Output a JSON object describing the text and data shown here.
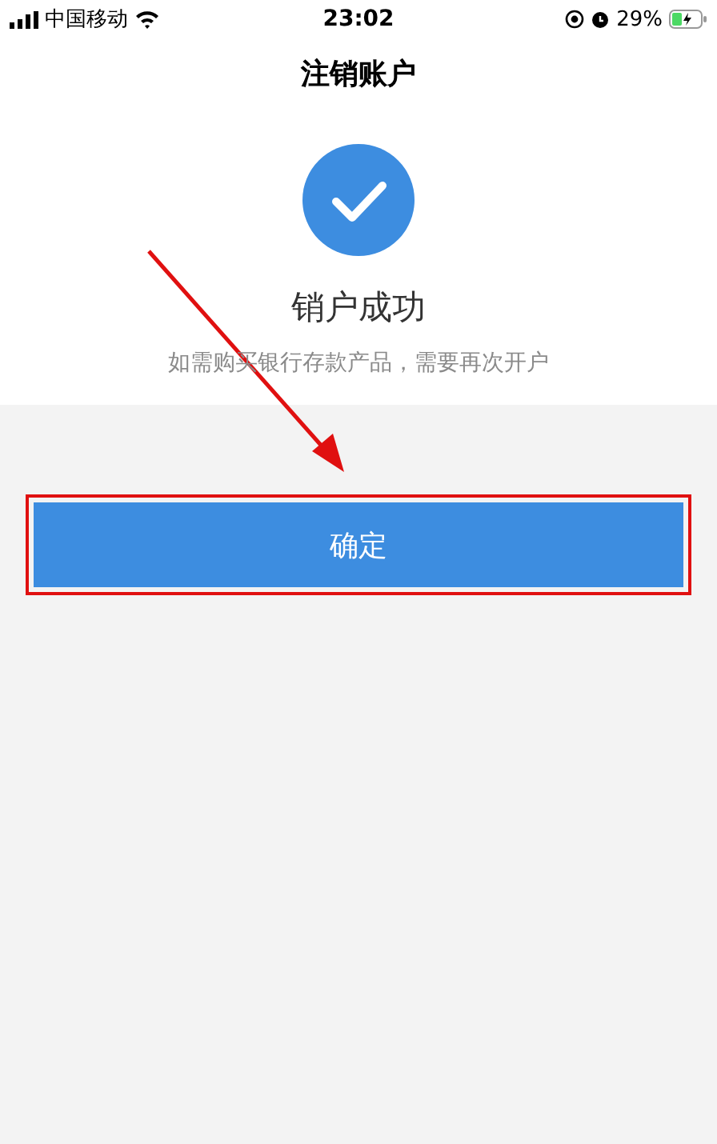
{
  "status_bar": {
    "carrier": "中国移动",
    "time": "23:02",
    "battery": "29%"
  },
  "title": "注销账户",
  "result": {
    "heading": "销户成功",
    "message": "如需购买银行存款产品，需要再次开户"
  },
  "button": "确定"
}
